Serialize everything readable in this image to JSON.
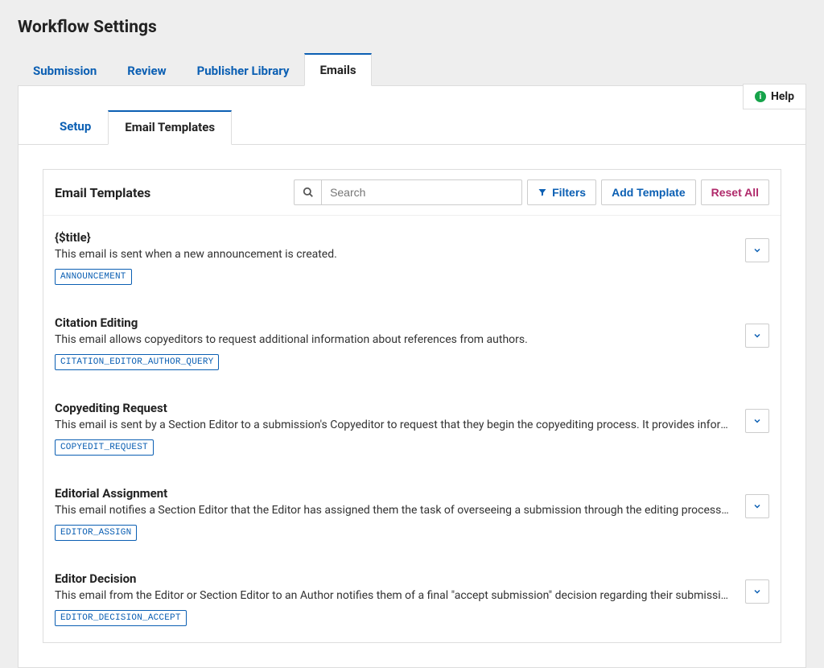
{
  "page_title": "Workflow Settings",
  "primary_tabs": {
    "submission": "Submission",
    "review": "Review",
    "publisher_library": "Publisher Library",
    "emails": "Emails"
  },
  "help_label": "Help",
  "secondary_tabs": {
    "setup": "Setup",
    "email_templates": "Email Templates"
  },
  "table": {
    "title": "Email Templates",
    "search_placeholder": "Search",
    "filters_label": "Filters",
    "add_template_label": "Add Template",
    "reset_all_label": "Reset All"
  },
  "templates": [
    {
      "name": "{$title}",
      "description": "This email is sent when a new announcement is created.",
      "key": "ANNOUNCEMENT"
    },
    {
      "name": "Citation Editing",
      "description": "This email allows copyeditors to request additional information about references from authors.",
      "key": "CITATION_EDITOR_AUTHOR_QUERY"
    },
    {
      "name": "Copyediting Request",
      "description": "This email is sent by a Section Editor to a submission's Copyeditor to request that they begin the copyediting process. It provides information about the submission and how to access it.",
      "key": "COPYEDIT_REQUEST"
    },
    {
      "name": "Editorial Assignment",
      "description": "This email notifies a Section Editor that the Editor has assigned them the task of overseeing a submission through the editing process. It provides information about the submission and how to access it.",
      "key": "EDITOR_ASSIGN"
    },
    {
      "name": "Editor Decision",
      "description": "This email from the Editor or Section Editor to an Author notifies them of a final \"accept submission\" decision regarding their submission.",
      "key": "EDITOR_DECISION_ACCEPT"
    }
  ]
}
